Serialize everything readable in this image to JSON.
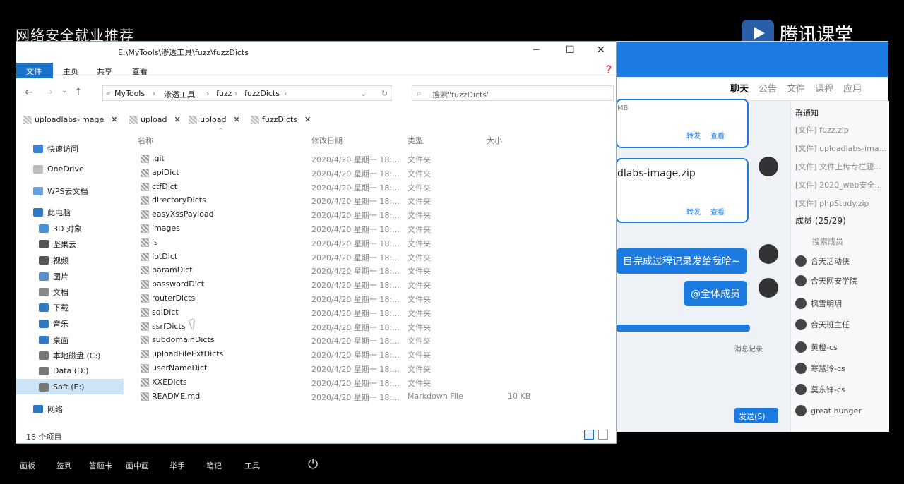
{
  "desktop": {
    "banner": "网络安全就业推荐",
    "brand": "腾讯课堂",
    "taskbar": [
      "画板",
      "签到",
      "答题卡",
      "画中画",
      "举手",
      "笔记",
      "工具"
    ]
  },
  "explorer": {
    "title": "E:\\MyTools\\渗透工具\\fuzz\\fuzzDicts",
    "ribbon": {
      "file": "文件",
      "home": "主页",
      "share": "共享",
      "view": "查看"
    },
    "address": [
      "MyTools",
      "渗透工具",
      "fuzz",
      "fuzzDicts"
    ],
    "search_placeholder": "搜索\"fuzzDicts\"",
    "tabs": [
      "uploadlabs-image",
      "upload",
      "upload",
      "fuzzDicts"
    ],
    "nav": [
      "快速访问",
      "OneDrive",
      "WPS云文档",
      "此电脑",
      "3D 对象",
      "坚果云",
      "视频",
      "图片",
      "文档",
      "下载",
      "音乐",
      "桌面",
      "本地磁盘 (C:)",
      "Data (D:)",
      "Soft (E:)",
      "网络"
    ],
    "columns": {
      "name": "名称",
      "date": "修改日期",
      "type": "类型",
      "size": "大小"
    },
    "files": [
      {
        "name": ".git",
        "date": "2020/4/20 星期一 18:...",
        "type": "文件夹",
        "size": ""
      },
      {
        "name": "apiDict",
        "date": "2020/4/20 星期一 18:...",
        "type": "文件夹",
        "size": ""
      },
      {
        "name": "ctfDict",
        "date": "2020/4/20 星期一 18:...",
        "type": "文件夹",
        "size": ""
      },
      {
        "name": "directoryDicts",
        "date": "2020/4/20 星期一 18:...",
        "type": "文件夹",
        "size": ""
      },
      {
        "name": "easyXssPayload",
        "date": "2020/4/20 星期一 18:...",
        "type": "文件夹",
        "size": ""
      },
      {
        "name": "images",
        "date": "2020/4/20 星期一 18:...",
        "type": "文件夹",
        "size": ""
      },
      {
        "name": "js",
        "date": "2020/4/20 星期一 18:...",
        "type": "文件夹",
        "size": ""
      },
      {
        "name": "IotDict",
        "date": "2020/4/20 星期一 18:...",
        "type": "文件夹",
        "size": ""
      },
      {
        "name": "paramDict",
        "date": "2020/4/20 星期一 18:...",
        "type": "文件夹",
        "size": ""
      },
      {
        "name": "passwordDict",
        "date": "2020/4/20 星期一 18:...",
        "type": "文件夹",
        "size": ""
      },
      {
        "name": "routerDicts",
        "date": "2020/4/20 星期一 18:...",
        "type": "文件夹",
        "size": ""
      },
      {
        "name": "sqlDict",
        "date": "2020/4/20 星期一 18:...",
        "type": "文件夹",
        "size": ""
      },
      {
        "name": "ssrfDicts",
        "date": "2020/4/20 星期一 18:...",
        "type": "文件夹",
        "size": ""
      },
      {
        "name": "subdomainDicts",
        "date": "2020/4/20 星期一 18:...",
        "type": "文件夹",
        "size": ""
      },
      {
        "name": "uploadFileExtDicts",
        "date": "2020/4/20 星期一 18:...",
        "type": "文件夹",
        "size": ""
      },
      {
        "name": "userNameDict",
        "date": "2020/4/20 星期一 18:...",
        "type": "文件夹",
        "size": ""
      },
      {
        "name": "XXEDicts",
        "date": "2020/4/20 星期一 18:...",
        "type": "文件夹",
        "size": ""
      },
      {
        "name": "README.md",
        "date": "2020/4/20 星期一 18:...",
        "type": "Markdown File",
        "size": "10 KB"
      }
    ],
    "status": "18 个项目"
  },
  "chat": {
    "tabs": [
      "聊天",
      "公告",
      "文件",
      "课程",
      "应用"
    ],
    "size_fragment": "MB",
    "forward": "转发",
    "view": "查看",
    "file_name": "dlabs-image.zip",
    "msg1": "目完成过程记录发给我哈~",
    "msg2": "@全体成员",
    "history": "消息记录",
    "send": "发送(S)",
    "group_notice": "群通知",
    "files": [
      "[文件] fuzz.zip",
      "[文件] uploadlabs-ima...",
      "[文件] 文件上传专栏题...",
      "[文件] 2020_web安全...",
      "[文件] phpStudy.zip"
    ],
    "members_title": "成员 (25/29)",
    "search_members": "搜索成员",
    "members": [
      "合天活动侠",
      "合天网安学院",
      "枫雪明玥",
      "合天班主任",
      "黄橙-cs",
      "寒慧玲-cs",
      "莫东锋-cs",
      "great hunger"
    ]
  }
}
